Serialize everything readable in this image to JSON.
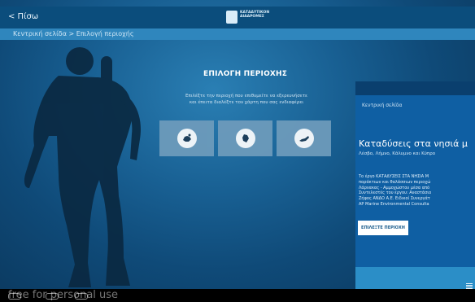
{
  "topbar": {
    "back_label": "< Πίσω",
    "logo_text_line1": "ΚΑΤΑΔΥΤΙΚΟΝ",
    "logo_text_line2": "ΔΙΑΔΡΟΜΕΣ"
  },
  "breadcrumb": "Κεντρική σελίδα > Επιλογή περιοχής",
  "main": {
    "title": "ΕΠΙΛΟΓΗ ΠΕΡΙΟΧΗΣ",
    "desc_line1": "Επιλέξτε την περιοχή που επιθυμείτε να εξερευνήσετε",
    "desc_line2": "και έπειτα διαλέξτε τον χάρτη που σας ενδιαφέρει",
    "tiles": [
      {
        "icon": "island-map-icon"
      },
      {
        "icon": "island-map-icon"
      },
      {
        "icon": "island-map-icon"
      }
    ]
  },
  "modal": {
    "breadcrumb": "Κεντρική σελίδα",
    "title": "Καταδύσεις στα νησιά μ",
    "subtitle": "Λέσβο, Λήμνο, Κάλυμνο και Κύπρο",
    "body_lines": [
      "Το έργο ΚΑΤΑΔΥΣΕΙΣ ΣΤΑ ΝΗΣΙΑ Μ",
      "παράκτιων και θαλάσσιων περιοχώ",
      "Λάρνακας - Αμμοχώστου μέσα από",
      "Συντελεστές του έργου: Αναστάσιο",
      "Ζήφος ΑΝΔΟ Α.Ε. Ειδικοί Συνεργάτ",
      "AP Marine Environmental Consulta"
    ],
    "button_label": "ΕΠΙΛΕΞΤΕ ΠΕΡΙΟΧΗ"
  },
  "footer": {
    "watermark": "free for personal use"
  },
  "colors": {
    "accent": "#2f86bd",
    "topbar": "#0b4d7c",
    "modal": "#0f5fa3"
  }
}
